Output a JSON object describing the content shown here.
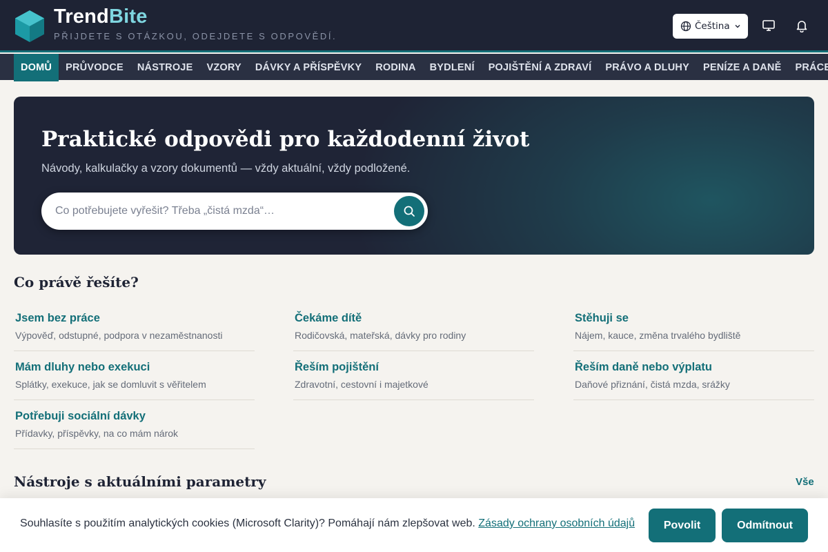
{
  "header": {
    "brand_main": "Trend",
    "brand_accent": "Bite",
    "tagline": "PŘIJDETE S OTÁZKOU, ODEJDETE S ODPOVĚDÍ.",
    "language": "Čeština",
    "icons": [
      "globe-icon",
      "chevron-down-icon",
      "monitor-icon",
      "bell-icon"
    ]
  },
  "nav": {
    "items": [
      {
        "label": "DOMŮ",
        "active": true
      },
      {
        "label": "PRŮVODCE"
      },
      {
        "label": "NÁSTROJE"
      },
      {
        "label": "VZORY"
      },
      {
        "label": "DÁVKY A PŘÍSPĚVKY"
      },
      {
        "label": "RODINA"
      },
      {
        "label": "BYDLENÍ"
      },
      {
        "label": "POJIŠTĚNÍ A ZDRAVÍ"
      },
      {
        "label": "PRÁVO A DLUHY"
      },
      {
        "label": "PENÍZE A DANĚ"
      },
      {
        "label": "PRÁCE"
      }
    ]
  },
  "hero": {
    "title": "Praktické odpovědi pro každodenní život",
    "subtitle": "Návody, kalkulačky a vzory dokumentů — vždy aktuální, vždy podložené.",
    "search_placeholder": "Co potřebujete vyřešit? Třeba „čistá mzda“…",
    "search_value": ""
  },
  "situations": {
    "title": "Co právě řešíte?",
    "items": [
      {
        "title": "Jsem bez práce",
        "desc": "Výpověď, odstupné, podpora v nezaměstnanosti"
      },
      {
        "title": "Čekáme dítě",
        "desc": "Rodičovská, mateřská, dávky pro rodiny"
      },
      {
        "title": "Stěhuji se",
        "desc": "Nájem, kauce, změna trvalého bydliště"
      },
      {
        "title": "Mám dluhy nebo exekuci",
        "desc": "Splátky, exekuce, jak se domluvit s věřitelem"
      },
      {
        "title": "Řeším pojištění",
        "desc": "Zdravotní, cestovní i majetkové"
      },
      {
        "title": "Řeším daně nebo výplatu",
        "desc": "Daňové přiznání, čistá mzda, srážky"
      },
      {
        "title": "Potřebuji sociální dávky",
        "desc": "Přídavky, příspěvky, na co mám nárok"
      }
    ]
  },
  "tools": {
    "title": "Nástroje s aktuálními parametry",
    "see_all": "Vše"
  },
  "cookie": {
    "message": "Souhlasíte s použitím analytických cookies (Microsoft Clarity)? Pomáhají nám zlepšovat web.",
    "link": "Zásady ochrany osobních údajů",
    "accept": "Povolit",
    "reject": "Odmítnout"
  },
  "colors": {
    "header_bg": "#1e2334",
    "nav_bg": "#2a3042",
    "accent": "#136f78",
    "brand_accent": "#7fd6e0",
    "page_bg": "#f5f3ef"
  }
}
